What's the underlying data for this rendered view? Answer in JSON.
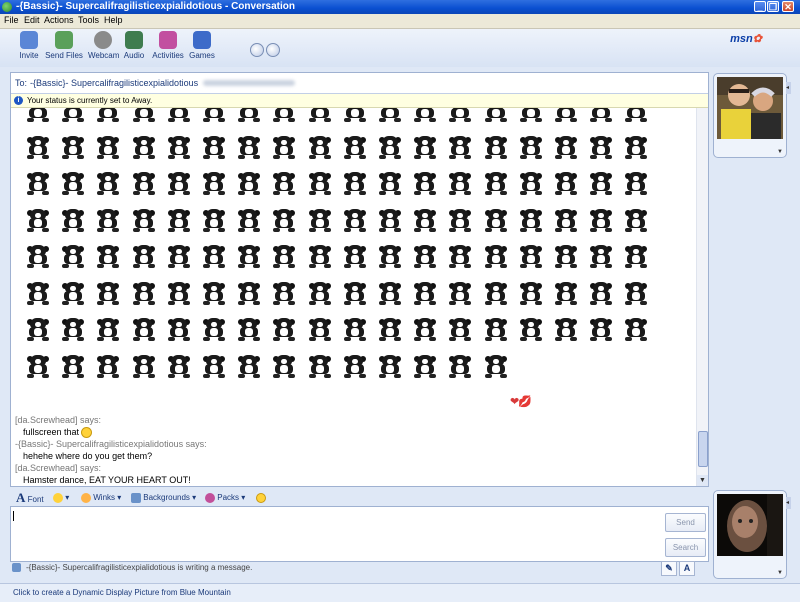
{
  "window": {
    "title": "-{Bassic}- Supercalifragilisticexpialidotious - Conversation",
    "controls": [
      "_",
      "❐",
      "✕"
    ]
  },
  "menu": [
    "File",
    "Edit",
    "Actions",
    "Tools",
    "Help"
  ],
  "toolbar": [
    {
      "label": "Invite",
      "icon": "invite-icon",
      "color": "#5a86d6"
    },
    {
      "label": "Send Files",
      "icon": "send-files-icon",
      "color": "#5aa05a"
    },
    {
      "label": "Webcam",
      "icon": "webcam-icon",
      "color": "#8a8a8a"
    },
    {
      "label": "Audio",
      "icon": "audio-icon",
      "color": "#3f7c4f"
    },
    {
      "label": "Activities",
      "icon": "activities-icon",
      "color": "#c24fa0"
    },
    {
      "label": "Games",
      "icon": "games-icon",
      "color": "#3d6bc9"
    }
  ],
  "brand": {
    "logo": "msn",
    "accent": "#0b3ea8"
  },
  "conversation": {
    "to_label": "To:",
    "to_name": "-{Bassic}- Supercalifragilisticexpialidotious",
    "status_notice": "Your status is currently set to Away."
  },
  "emoticon_grid": {
    "rows": 8,
    "columns": 18,
    "last_row_count": 14,
    "emote_name": "dancing-hamster-emoticon"
  },
  "messages": [
    {
      "sender": "[da.Screwhead] says:",
      "text": "fullscreen that",
      "emoji": "wink-emoticon"
    },
    {
      "sender": "-{Bassic}- Supercalifragilisticexpialidotious says:",
      "text": "hehehe where do you get them?"
    },
    {
      "sender": "[da.Screwhead] says:",
      "text": "Hamster dance, EAT YOUR HEART OUT!"
    }
  ],
  "format_bar": {
    "font_label": "Font",
    "winks_label": "Winks",
    "backgrounds_label": "Backgrounds",
    "packs_label": "Packs"
  },
  "input": {
    "value": "",
    "send_label": "Send",
    "search_label": "Search"
  },
  "typing_status": "-{Bassic}- Supercalifragilisticexpialidotious is writing a message.",
  "bottom_link": "Click to create a Dynamic Display Picture from Blue Mountain"
}
